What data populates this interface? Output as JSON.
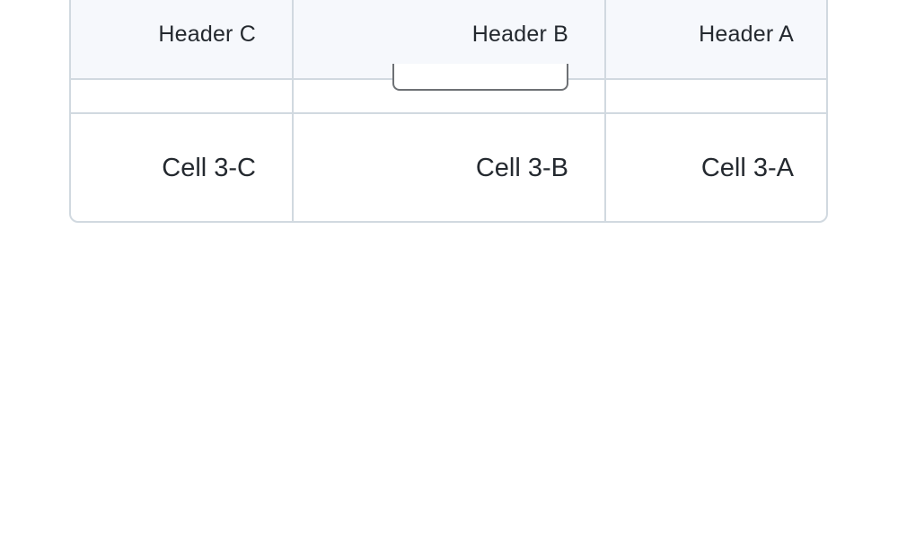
{
  "table": {
    "headers": [
      "Header C",
      "Header B",
      "Header A"
    ],
    "rows": [
      {
        "cells": [
          "Cell 3-C",
          "Cell 3-B",
          "Cell 3-A"
        ]
      }
    ]
  }
}
